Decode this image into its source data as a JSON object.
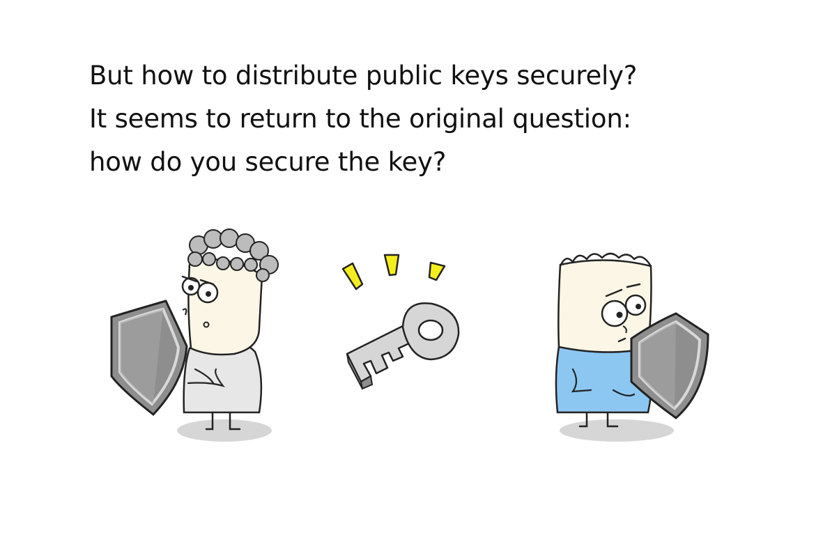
{
  "caption": {
    "line1": "But how to distribute public keys securely?",
    "line2": "It seems to return to the original question:",
    "line3": "how do you secure the key?"
  },
  "illustration": {
    "left_character": "curly-haired-character-with-shield",
    "right_character": "blue-shirt-character-with-shield",
    "center_object": "key-icon",
    "accent_colors": {
      "spark": "#f5ee1c",
      "shirt_blue": "#8cc7f2",
      "shield_grey": "#8e8e8e",
      "skin": "#fbf6e6"
    }
  }
}
